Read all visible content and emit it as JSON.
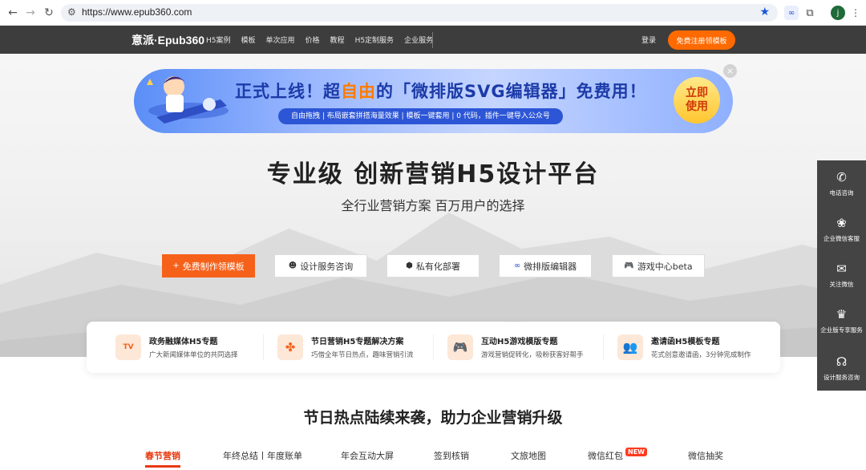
{
  "browser": {
    "url": "https://www.epub360.com",
    "profile_initial": "j"
  },
  "nav": {
    "logo": "意派·Epub360",
    "items": [
      "H5案例",
      "模板",
      "单次应用",
      "价格",
      "教程",
      "H5定制服务",
      "企业服务"
    ],
    "login": "登录",
    "register": "免费注册领模板"
  },
  "banner": {
    "title_pre": "正式上线！超",
    "title_highlight": "自由",
    "title_post": "的「微排版SVG编辑器」免费用！",
    "subtitle": "自由拖拽 | 布局嵌套拼搭海量效果 | 模板一键套用 | 0 代码，插件一键导入公众号",
    "cta": "立即使用",
    "close": "×"
  },
  "hero": {
    "headline": "专业级  创新营销H5设计平台",
    "subline": "全行业营销方案  百万用户的选择",
    "buttons": [
      {
        "label": "免费制作领模板",
        "icon": "+"
      },
      {
        "label": "设计服务咨询",
        "icon": "☻"
      },
      {
        "label": "私有化部署",
        "icon": "⬢"
      },
      {
        "label": "微排版编辑器",
        "icon": "∞"
      },
      {
        "label": "游戏中心beta",
        "icon": "🎮"
      }
    ]
  },
  "cards": [
    {
      "title": "政务融媒体H5专题",
      "desc": "广大新闻媒体单位的共同选择",
      "icon": "TV"
    },
    {
      "title": "节日营销H5专题解决方案",
      "desc": "巧借全年节日热点，趣味营销引流",
      "icon": "✤"
    },
    {
      "title": "互动H5游戏模版专题",
      "desc": "游戏营销促转化，吸粉获客好帮手",
      "icon": "🎮"
    },
    {
      "title": "邀请函H5模板专题",
      "desc": "花式创意邀请函，3分钟完成制作",
      "icon": "👥"
    }
  ],
  "section": {
    "title": "节日热点陆续来袭，助力企业营销升级",
    "tabs": [
      "春节营销",
      "年终总结丨年度账单",
      "年会互动大屏",
      "签到核销",
      "文旅地图",
      "微信红包",
      "微信抽奖"
    ],
    "new_badge": "NEW"
  },
  "float_bar": [
    {
      "label": "电话咨询",
      "icon": "✆"
    },
    {
      "label": "企业微信客服",
      "icon": "❀"
    },
    {
      "label": "关注微信",
      "icon": "✉"
    },
    {
      "label": "企业版专享服务",
      "icon": "♛"
    },
    {
      "label": "设计服务咨询",
      "icon": "☊"
    }
  ]
}
